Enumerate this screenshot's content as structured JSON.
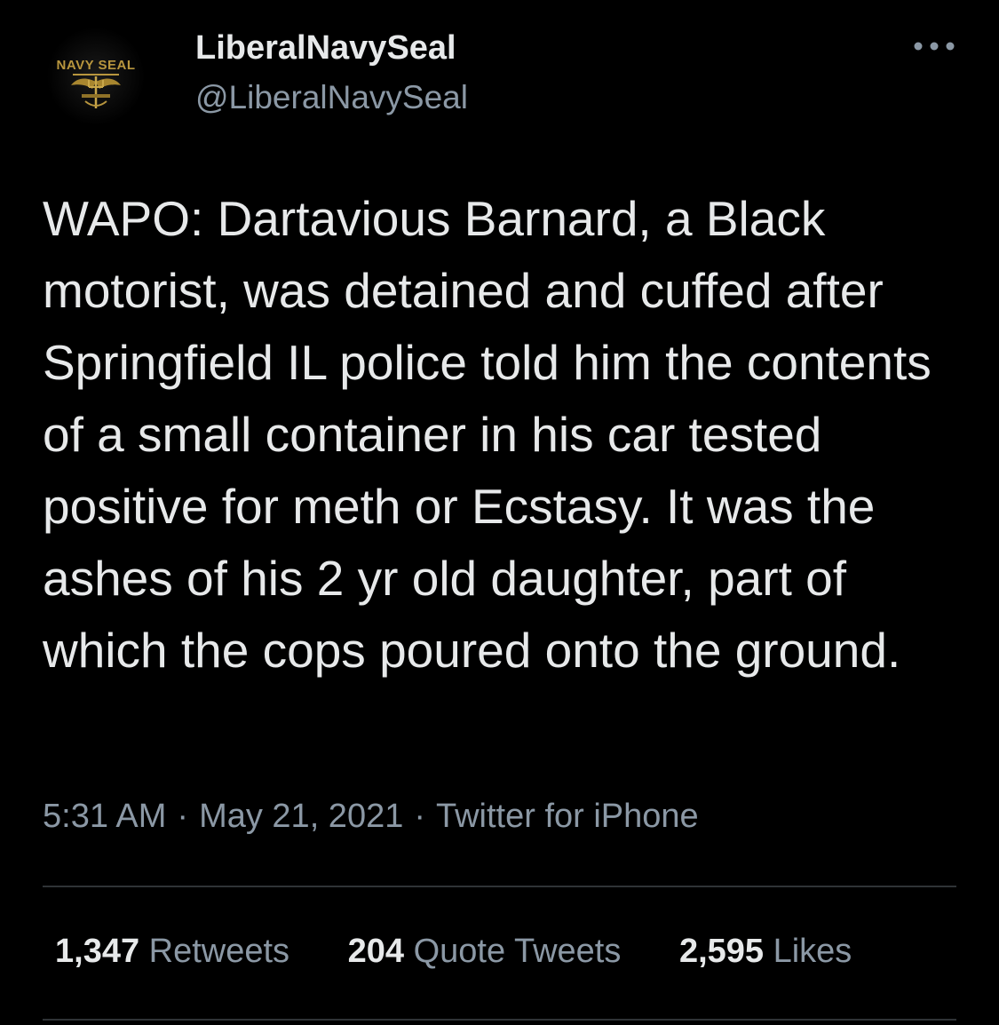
{
  "author": {
    "avatar_icon": "navy-seal-trident-icon",
    "avatar_text": "NAVY SEAL",
    "display_name": "LiberalNavySeal",
    "handle": "@LiberalNavySeal"
  },
  "more_icon": "more-horizontal-icon",
  "tweet_text": "WAPO: Dartavious Barnard, a Black motorist, was detained and cuffed after Springfield IL police told him the contents of a small container in his car tested positive for meth or Ecstasy. It was the ashes of his 2 yr old daughter, part of which the cops poured onto the ground.",
  "meta": {
    "time": "5:31 AM",
    "separator": "·",
    "date": "May 21, 2021",
    "source": "Twitter for iPhone"
  },
  "stats": {
    "retweets": {
      "count": "1,347",
      "label": "Retweets"
    },
    "quote_tweets": {
      "count": "204",
      "label": "Quote Tweets"
    },
    "likes": {
      "count": "2,595",
      "label": "Likes"
    }
  },
  "colors": {
    "background": "#000000",
    "primary_text": "#e7e9ea",
    "secondary_text": "#8b98a5",
    "divider": "#2f3336",
    "avatar_gold": "#b8963e"
  }
}
